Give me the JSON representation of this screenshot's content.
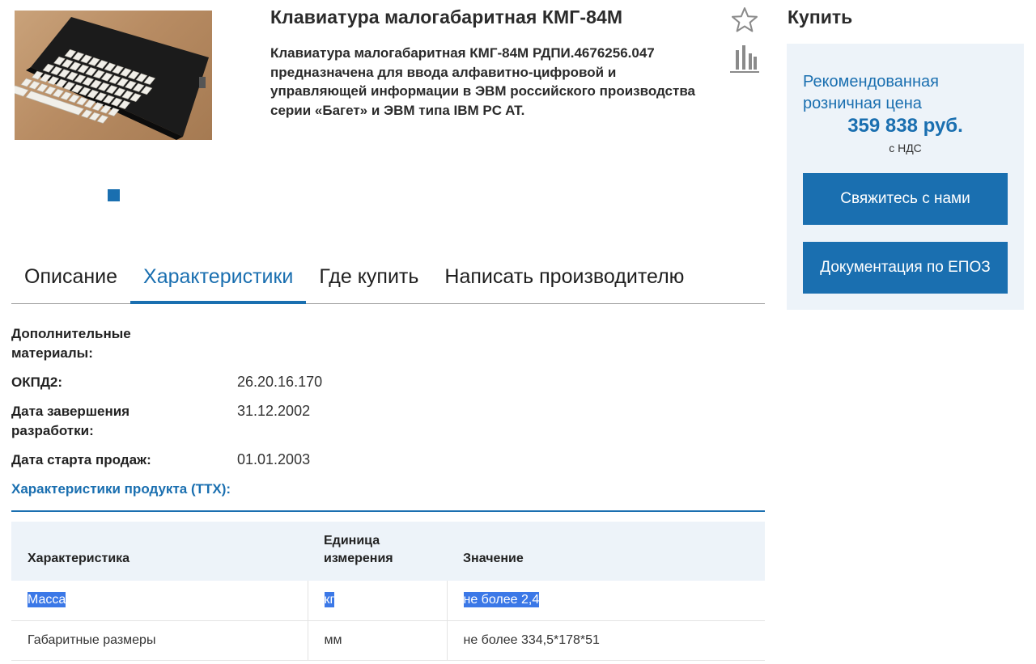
{
  "product": {
    "title": "Клавиатура малогабаритная КМГ-84М",
    "description": "Клавиатура малогабаритная КМГ-84М РДПИ.4676256.047 предназначена для ввода алфавитно-цифровой и управляющей информации в ЭВМ российского производства серии «Багет» и ЭВМ типа IBM PC AT.",
    "image_icon": "keyboard-photo",
    "favorite_icon": "star-icon",
    "compare_icon": "compare-bars-icon"
  },
  "buy": {
    "heading": "Купить",
    "price_label": "Рекомендованная розничная цена",
    "price": "359 838 руб.",
    "vat": "с НДС",
    "contact_button": "Свяжитесь с нами",
    "docs_button": "Документация по ЕПОЗ"
  },
  "tabs": [
    {
      "label": "Описание",
      "active": false
    },
    {
      "label": "Характеристики",
      "active": true
    },
    {
      "label": "Где купить",
      "active": false
    },
    {
      "label": "Написать производителю",
      "active": false
    }
  ],
  "properties": [
    {
      "label": "Дополнительные материалы:",
      "value": ""
    },
    {
      "label": "ОКПД2:",
      "value": "26.20.16.170"
    },
    {
      "label": "Дата завершения разработки:",
      "value": "31.12.2002"
    },
    {
      "label": "Дата старта продаж:",
      "value": "01.01.2003"
    }
  ],
  "ttx": {
    "heading": "Характеристики продукта (ТТХ):",
    "columns": [
      "Характеристика",
      "Единица измерения",
      "Значение"
    ],
    "rows": [
      [
        "Масса",
        "кг",
        "не более 2,4"
      ],
      [
        "Габаритные размеры",
        "мм",
        "не более 334,5*178*51"
      ]
    ]
  },
  "colors": {
    "accent": "#1a6fb0",
    "panel_bg": "#edf3f9",
    "selection": "#3b78e7"
  }
}
